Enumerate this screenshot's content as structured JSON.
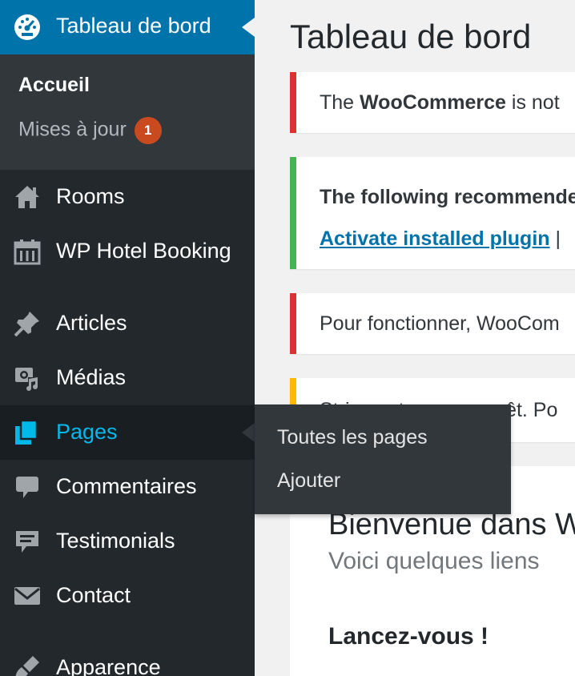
{
  "sidebar": {
    "dashboard_label": "Tableau de bord",
    "submenu": {
      "home": "Accueil",
      "updates": "Mises à jour",
      "updates_count": "1"
    },
    "items": [
      {
        "label": "Rooms",
        "icon": "home-icon"
      },
      {
        "label": "WP Hotel Booking",
        "icon": "calendar-icon"
      },
      {
        "label": "Articles",
        "icon": "pin-icon"
      },
      {
        "label": "Médias",
        "icon": "media-icon"
      },
      {
        "label": "Pages",
        "icon": "pages-icon"
      },
      {
        "label": "Commentaires",
        "icon": "comment-icon"
      },
      {
        "label": "Testimonials",
        "icon": "testimonial-icon"
      },
      {
        "label": "Contact",
        "icon": "mail-icon"
      },
      {
        "label": "Apparence",
        "icon": "brush-icon"
      }
    ],
    "flyout": {
      "all_pages": "Toutes les pages",
      "add": "Ajouter"
    }
  },
  "main": {
    "title": "Tableau de bord",
    "notices": [
      {
        "prefix": "The ",
        "strong": "WooCommerce",
        "suffix": " is not",
        "color": "#dc3232"
      },
      {
        "heading": "The following recommended",
        "link": "Activate installed plugin",
        "after": " |",
        "color": "#46b450"
      },
      {
        "text": "Pour fonctionner, WooCom",
        "color": "#dc3232"
      },
      {
        "text": "Stripe est presque prêt. Po",
        "color": "#ffb900"
      }
    ],
    "welcome": {
      "title": "Bienvenue dans W",
      "subtitle": "Voici quelques liens",
      "section": "Lancez-vous !"
    }
  },
  "colors": {
    "sidebar_bg": "#23282d",
    "active_blue": "#0073aa",
    "hover_blue": "#00b9eb",
    "badge": "#ca4a1f"
  }
}
